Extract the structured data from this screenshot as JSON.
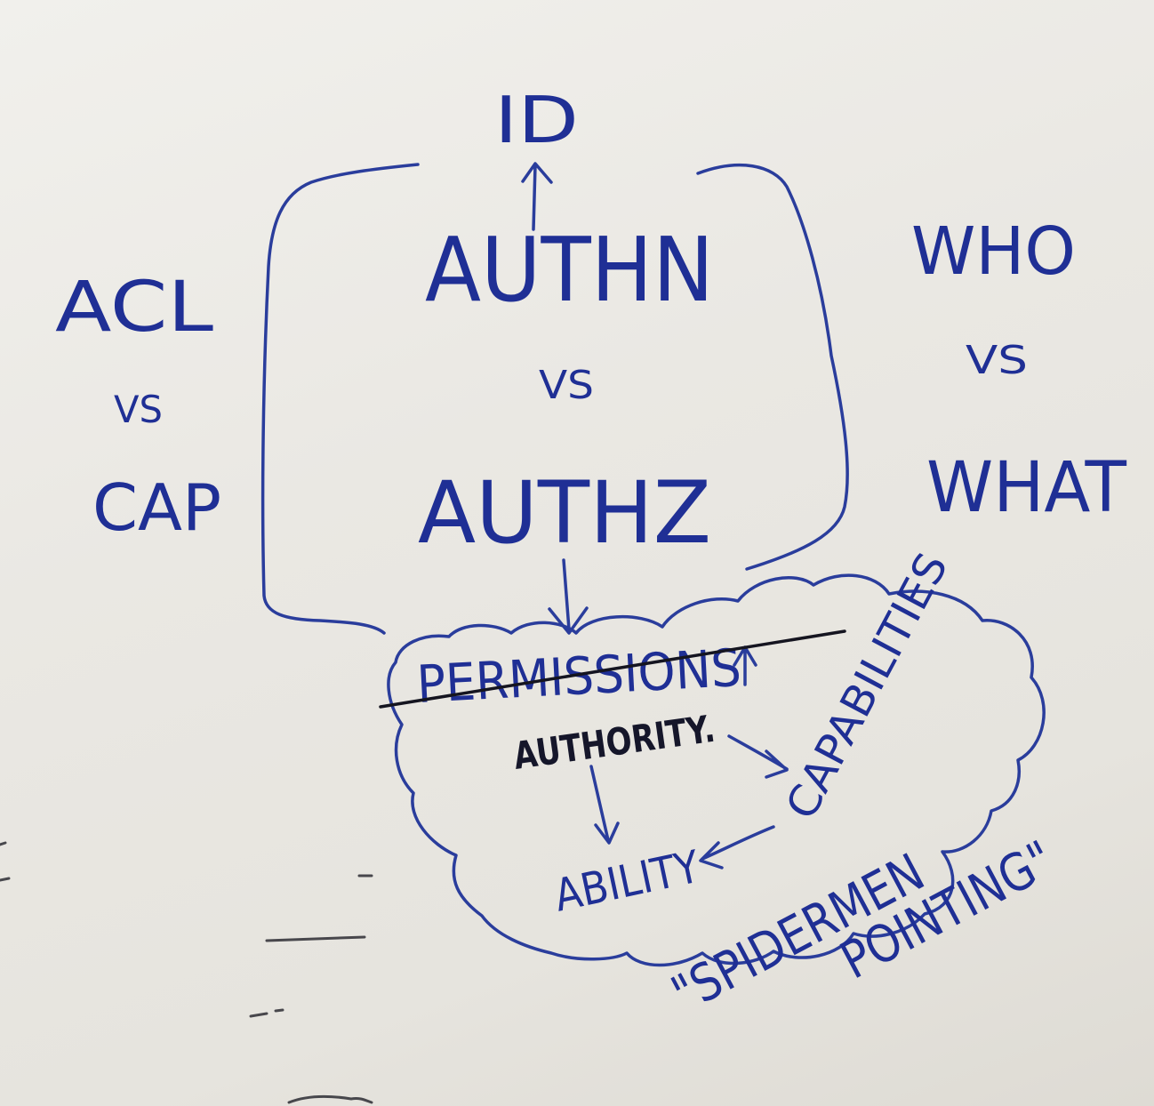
{
  "whiteboard": {
    "id_label": "ID",
    "authn_label": "AUTHN",
    "authn_vs": "VS",
    "authz_label": "AUTHZ",
    "acl_label": "ACL",
    "acl_vs": "VS",
    "cap_label": "CAP",
    "who_label": "WHO",
    "who_vs": "VS",
    "what_label": "WHAT",
    "permissions_label": "PERMISSIONS",
    "authority_label": "AUTHORITY.",
    "capabilities_label": "CAPABILITIES",
    "ability_label": "ABILITY",
    "spidermen_label": "\"SPIDERMEN",
    "pointing_label": "POINTING\""
  },
  "colors": {
    "marker_blue": "#1f2f95",
    "marker_black": "#15162a",
    "board": "#eeece7"
  }
}
